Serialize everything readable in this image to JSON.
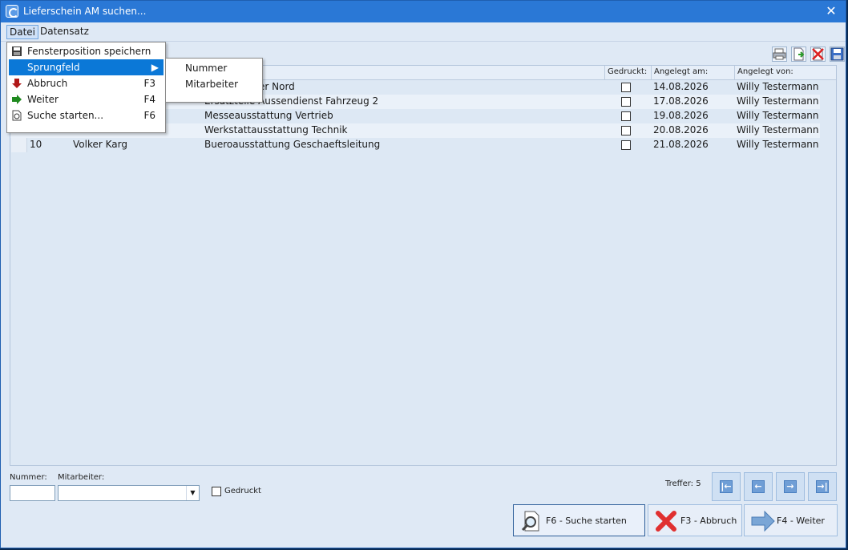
{
  "window": {
    "title": "Lieferschein AM suchen...",
    "close_glyph": "✕"
  },
  "menubar": {
    "items": [
      "Datei",
      "Datensatz"
    ]
  },
  "menu": {
    "items": [
      {
        "label": "Fensterposition speichern",
        "shortcut": "",
        "icon": "save-icon"
      },
      {
        "label": "Sprungfeld",
        "shortcut": "",
        "icon": "",
        "submenu": true
      },
      {
        "label": "Abbruch",
        "shortcut": "F3",
        "icon": "red-arrow-down-icon"
      },
      {
        "label": "Weiter",
        "shortcut": "F4",
        "icon": "green-arrow-right-icon"
      },
      {
        "label": "Suche starten...",
        "shortcut": "F6",
        "icon": "search-document-icon"
      }
    ],
    "submenu": {
      "items": [
        "Nummer",
        "Mitarbeiter"
      ]
    }
  },
  "toolbar": {
    "icons": [
      "printer-icon",
      "export-document-icon",
      "delete-icon",
      "save-icon"
    ]
  },
  "grid": {
    "columns": [
      "Gedruckt:",
      "Angelegt am:",
      "Angelegt von:"
    ],
    "rows": [
      {
        "nummer": "",
        "mitarbeiter": "",
        "bezeichnung": "er Nord",
        "gedruckt": false,
        "angelegt_am": "14.08.2026",
        "angelegt_von": "Willy Testermann"
      },
      {
        "nummer": "",
        "mitarbeiter": "",
        "bezeichnung": "Ersatzteile Aussendienst Fahrzeug 2",
        "gedruckt": false,
        "angelegt_am": "17.08.2026",
        "angelegt_von": "Willy Testermann"
      },
      {
        "nummer": "",
        "mitarbeiter": "",
        "bezeichnung": "Messeausstattung Vertrieb",
        "gedruckt": false,
        "angelegt_am": "19.08.2026",
        "angelegt_von": "Willy Testermann"
      },
      {
        "nummer": "",
        "mitarbeiter": "",
        "bezeichnung": "Werkstattausstattung Technik",
        "gedruckt": false,
        "angelegt_am": "20.08.2026",
        "angelegt_von": "Willy Testermann"
      },
      {
        "nummer": "10",
        "mitarbeiter": "Volker Karg",
        "bezeichnung": "Bueroausstattung Geschaeftsleitung",
        "gedruckt": false,
        "angelegt_am": "21.08.2026",
        "angelegt_von": "Willy Testermann"
      }
    ]
  },
  "filters": {
    "nummer_label": "Nummer:",
    "nummer_value": "",
    "mitarbeiter_label": "Mitarbeiter:",
    "mitarbeiter_value": "",
    "gedruckt_label": "Gedruckt"
  },
  "status": {
    "treffer": "Treffer: 5"
  },
  "nav": {
    "first": "|←",
    "prev": "←",
    "next": "→",
    "last": "→|"
  },
  "buttons": {
    "search": {
      "label": "F6 - Suche starten"
    },
    "cancel": {
      "label": "F3 - Abbruch"
    },
    "next": {
      "label": "F4 - Weiter"
    }
  }
}
